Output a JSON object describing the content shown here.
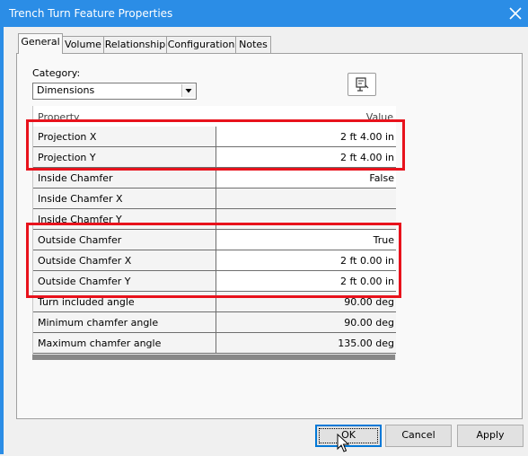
{
  "window": {
    "title": "Trench Turn Feature Properties"
  },
  "tabs": [
    {
      "label": "General",
      "active": true
    },
    {
      "label": "Volume",
      "active": false
    },
    {
      "label": "Relationship",
      "active": false
    },
    {
      "label": "Configuration",
      "active": false
    },
    {
      "label": "Notes",
      "active": false
    }
  ],
  "category": {
    "label": "Category:",
    "selected": "Dimensions"
  },
  "grid": {
    "header": {
      "property": "Property",
      "value": "Value"
    },
    "rows": [
      {
        "property": "Projection X",
        "value": "2 ft  4.00 in"
      },
      {
        "property": "Projection Y",
        "value": "2 ft  4.00 in"
      },
      {
        "property": "Inside Chamfer",
        "value": "False"
      },
      {
        "property": "Inside Chamfer X",
        "value": ""
      },
      {
        "property": "Inside Chamfer Y",
        "value": ""
      },
      {
        "property": "Outside Chamfer",
        "value": "True"
      },
      {
        "property": "Outside Chamfer X",
        "value": "2 ft  0.00 in"
      },
      {
        "property": "Outside Chamfer Y",
        "value": "2 ft  0.00 in"
      },
      {
        "property": "Turn included angle",
        "value": "90.00 deg"
      },
      {
        "property": "Minimum chamfer angle",
        "value": "90.00 deg"
      },
      {
        "property": "Maximum chamfer angle",
        "value": "135.00 deg"
      }
    ]
  },
  "buttons": {
    "ok": "OK",
    "cancel": "Cancel",
    "apply": "Apply"
  },
  "colors": {
    "titlebar": "#2b8de6",
    "highlight": "#e8121c"
  },
  "icons": {
    "close": "close-icon",
    "tool": "properties-tool-icon",
    "dropdown": "chevron-down-icon",
    "cursor": "mouse-pointer-icon"
  }
}
